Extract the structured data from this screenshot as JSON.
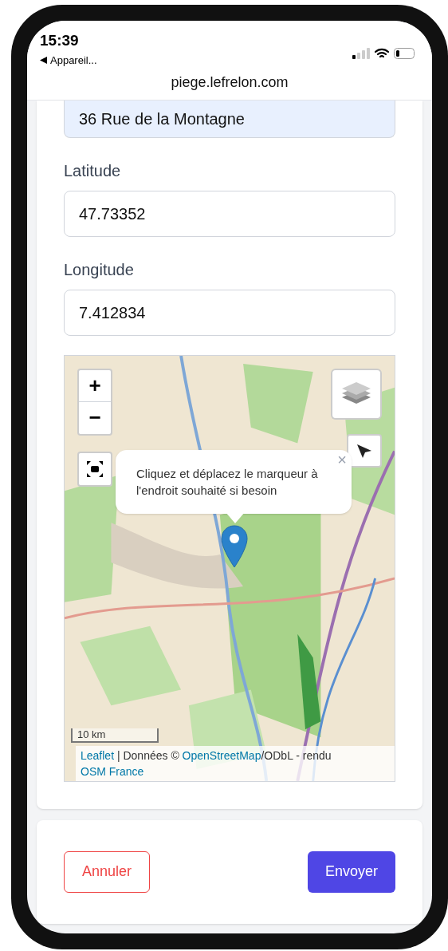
{
  "status_bar": {
    "time": "15:39",
    "back_label": "Appareil..."
  },
  "url": "piege.lefrelon.com",
  "address": {
    "value": "36 Rue de la Montagne"
  },
  "fields": [
    {
      "label": "Latitude",
      "value": "47.73352"
    },
    {
      "label": "Longitude",
      "value": "7.412834"
    }
  ],
  "map": {
    "zoom_in": "+",
    "zoom_out": "−",
    "popup": {
      "text": "Cliquez et déplacez le marqueur à l'endroit souhaité si besoin",
      "close": "×"
    },
    "scale": "10 km",
    "attribution": [
      {
        "text": "Leaflet",
        "link": true
      },
      {
        "text": " | Données © ",
        "link": false
      },
      {
        "text": "OpenStreetMap",
        "link": true
      },
      {
        "text": "/ODbL - rendu ",
        "link": false
      },
      {
        "text": "OSM France",
        "link": true
      }
    ]
  },
  "buttons": [
    {
      "label": "Annuler",
      "kind": "secondary"
    },
    {
      "label": "Envoyer",
      "kind": "primary"
    }
  ]
}
